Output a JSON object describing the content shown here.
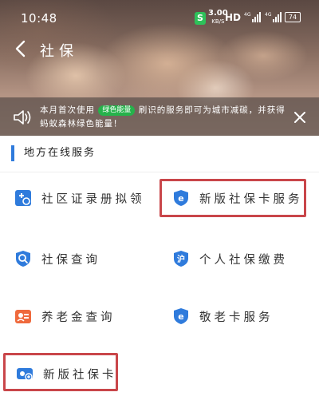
{
  "status_bar": {
    "time": "10:48",
    "net_badge": "S",
    "speed_value": "3.00",
    "speed_unit": "KB/S",
    "hd": "HD",
    "signal_1": "4G",
    "signal_2": "4G",
    "battery": "74"
  },
  "nav": {
    "title": "社保"
  },
  "notice": {
    "text_before": "本月首次使用",
    "tag": "绿色能量",
    "text_after": "刷识的服务即可为城市减碳，并获得蚂蚁森林绿色能量！"
  },
  "section": {
    "title": "地方在线服务"
  },
  "services": [
    {
      "label": "社区证录册拟领",
      "icon": "plus-doc-icon",
      "highlighted": false
    },
    {
      "label": "新版社保卡服务",
      "icon": "e-shield-icon",
      "highlighted": true
    },
    {
      "label": "社保查询",
      "icon": "search-shield-icon",
      "highlighted": false
    },
    {
      "label": "个人社保缴费",
      "icon": "hu-shield-icon",
      "highlighted": false
    },
    {
      "label": "养老金查询",
      "icon": "pension-icon",
      "highlighted": false
    },
    {
      "label": "敬老卡服务",
      "icon": "e-shield-icon",
      "highlighted": false
    },
    {
      "label": "新版社保卡",
      "icon": "card-icon",
      "highlighted": true
    }
  ],
  "colors": {
    "accent_blue": "#2f7bdc",
    "highlight_red": "#c9464a",
    "energy_green": "#26b24b"
  }
}
